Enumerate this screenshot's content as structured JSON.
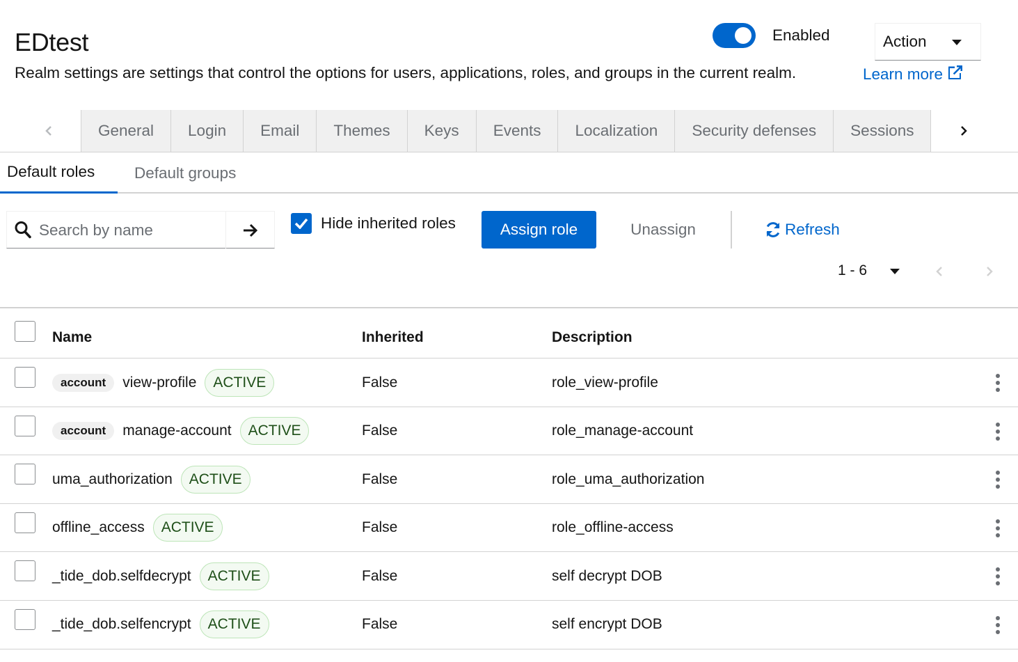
{
  "header": {
    "title": "EDtest",
    "subtitle": "Realm settings are settings that control the options for users, applications, roles, and groups in the current realm.",
    "learn_more": "Learn more",
    "enabled_label": "Enabled",
    "enabled": true,
    "action_label": "Action"
  },
  "tabs": [
    {
      "label": "General"
    },
    {
      "label": "Login"
    },
    {
      "label": "Email"
    },
    {
      "label": "Themes"
    },
    {
      "label": "Keys"
    },
    {
      "label": "Events"
    },
    {
      "label": "Localization"
    },
    {
      "label": "Security defenses"
    },
    {
      "label": "Sessions"
    }
  ],
  "subtabs": {
    "active": "Default roles",
    "inactive": "Default groups"
  },
  "toolbar": {
    "search_placeholder": "Search by name",
    "hide_inherited_label": "Hide inherited roles",
    "hide_inherited_checked": true,
    "assign_label": "Assign role",
    "unassign_label": "Unassign",
    "refresh_label": "Refresh"
  },
  "pagination": {
    "range": "1 - 6"
  },
  "table": {
    "columns": {
      "name": "Name",
      "inherited": "Inherited",
      "description": "Description"
    },
    "rows": [
      {
        "client": "account",
        "name": "view-profile",
        "status": "ACTIVE",
        "inherited": "False",
        "description": "role_view-profile"
      },
      {
        "client": "account",
        "name": "manage-account",
        "status": "ACTIVE",
        "inherited": "False",
        "description": "role_manage-account"
      },
      {
        "client": "",
        "name": "uma_authorization",
        "status": "ACTIVE",
        "inherited": "False",
        "description": "role_uma_authorization"
      },
      {
        "client": "",
        "name": "offline_access",
        "status": "ACTIVE",
        "inherited": "False",
        "description": "role_offline-access"
      },
      {
        "client": "",
        "name": "_tide_dob.selfdecrypt",
        "status": "ACTIVE",
        "inherited": "False",
        "description": "self decrypt DOB"
      },
      {
        "client": "",
        "name": "_tide_dob.selfencrypt",
        "status": "ACTIVE",
        "inherited": "False",
        "description": "self encrypt DOB"
      }
    ]
  },
  "colors": {
    "primary": "#0066cc",
    "text": "#151515",
    "muted": "#6a6e73",
    "border": "#d2d2d2",
    "tab_bg": "#f0f0f0",
    "active_label_bg": "#f3faf2",
    "active_label_text": "#1e4f18"
  },
  "icons": {
    "external": "external-link-icon",
    "search": "search-icon",
    "arrow": "arrow-right-icon",
    "refresh": "refresh-icon",
    "kebab": "kebab-icon"
  }
}
